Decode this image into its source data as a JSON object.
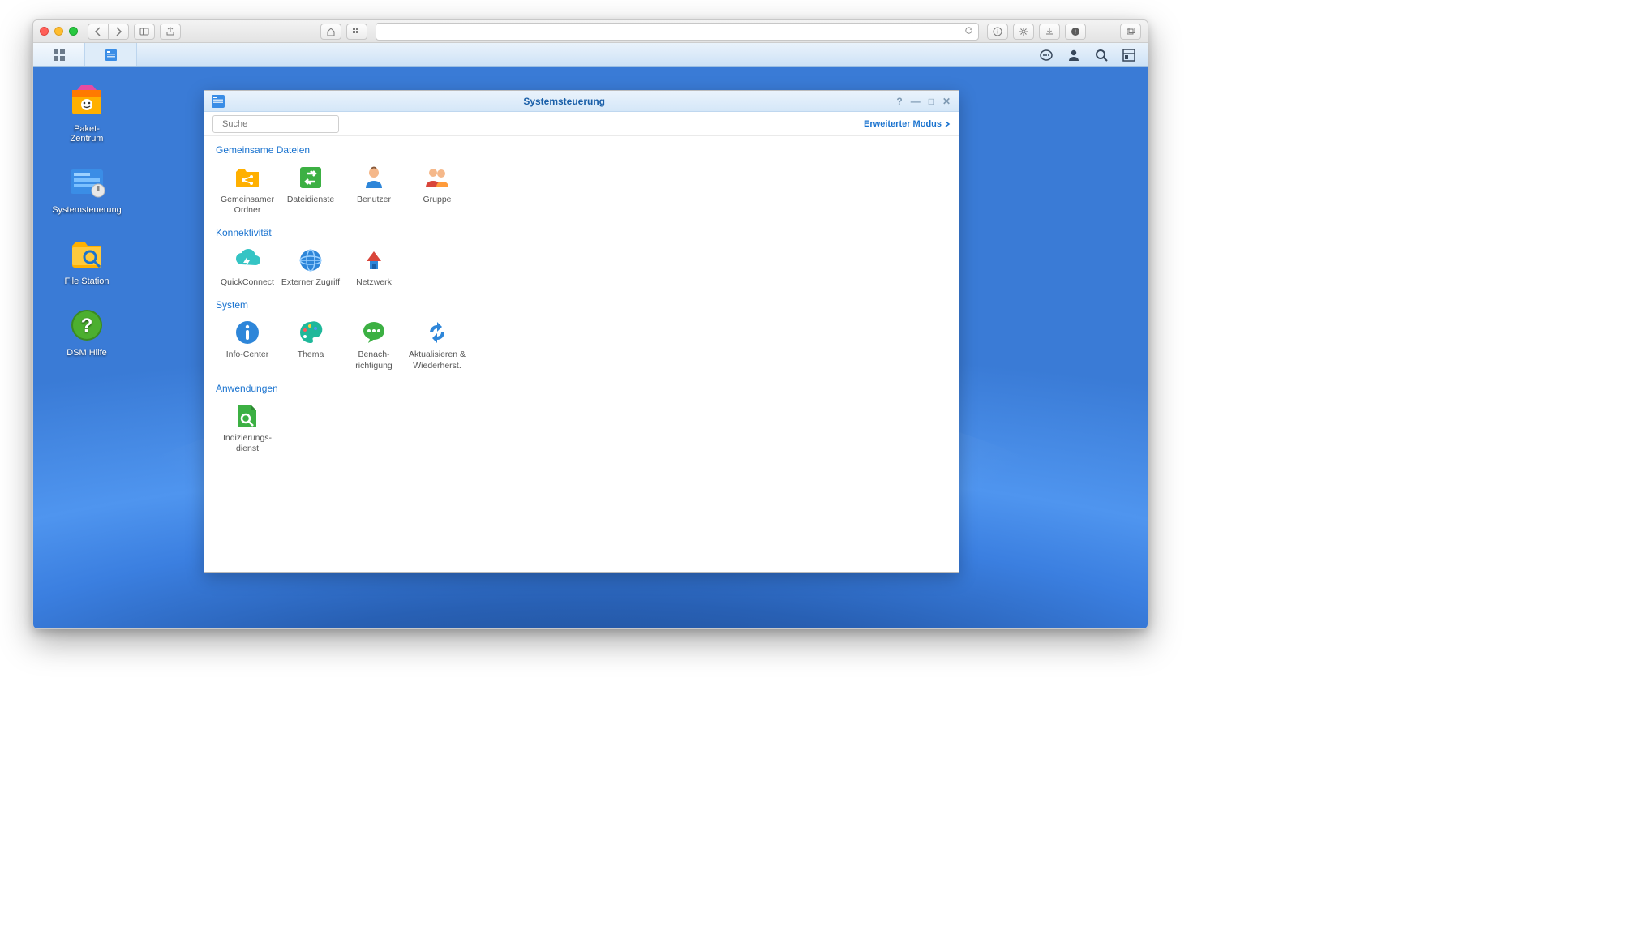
{
  "browser": {
    "reader_icon": "reader",
    "share_icon": "share",
    "home_icon": "home",
    "apps_icon": "apps",
    "reload_icon": "reload",
    "new_tab": "+"
  },
  "dsm_tray": {
    "divider": "|"
  },
  "desktop_icons": [
    {
      "id": "package-center",
      "label": "Paket-\nZentrum"
    },
    {
      "id": "control-panel",
      "label": "Systemsteuerung"
    },
    {
      "id": "file-station",
      "label": "File Station"
    },
    {
      "id": "dsm-help",
      "label": "DSM Hilfe"
    }
  ],
  "cp": {
    "title": "Systemsteuerung",
    "search_placeholder": "Suche",
    "advanced_mode": "Erweiterter Modus",
    "sections": [
      {
        "title": "Gemeinsame Dateien",
        "items": [
          {
            "id": "shared-folder",
            "label": "Gemeinsamer\nOrdner"
          },
          {
            "id": "file-services",
            "label": "Dateidienste"
          },
          {
            "id": "user",
            "label": "Benutzer"
          },
          {
            "id": "group",
            "label": "Gruppe"
          }
        ]
      },
      {
        "title": "Konnektivität",
        "items": [
          {
            "id": "quickconnect",
            "label": "QuickConnect"
          },
          {
            "id": "external-access",
            "label": "Externer Zugriff"
          },
          {
            "id": "network",
            "label": "Netzwerk"
          }
        ]
      },
      {
        "title": "System",
        "items": [
          {
            "id": "info-center",
            "label": "Info-Center"
          },
          {
            "id": "theme",
            "label": "Thema"
          },
          {
            "id": "notification",
            "label": "Benach-\nrichtigung"
          },
          {
            "id": "update-restore",
            "label": "Aktualisieren &\nWiederherst."
          }
        ]
      },
      {
        "title": "Anwendungen",
        "items": [
          {
            "id": "indexing",
            "label": "Indizierungs-\ndienst"
          }
        ]
      }
    ]
  }
}
